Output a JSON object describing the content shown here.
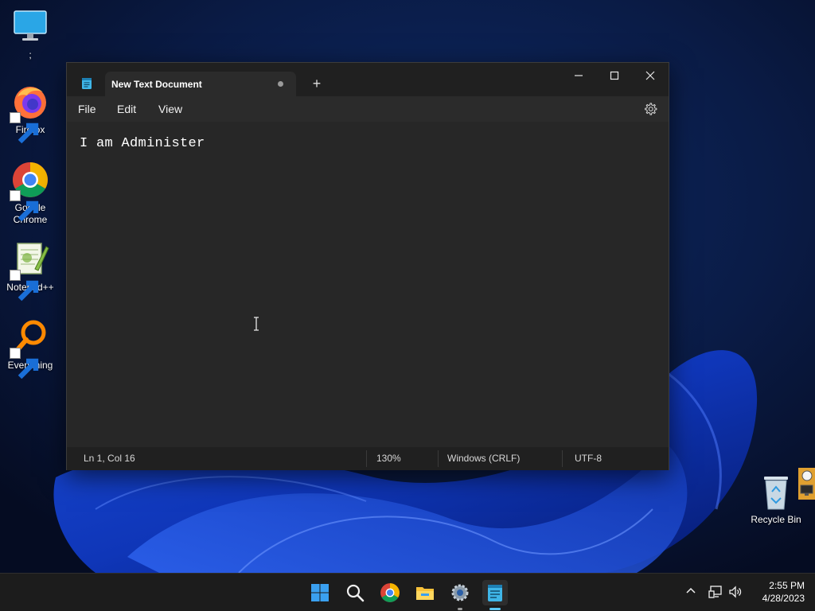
{
  "desktop": {
    "icons": [
      {
        "label": ";",
        "icon": "monitor-icon"
      },
      {
        "label": "Firefox",
        "icon": "firefox-icon"
      },
      {
        "label": "Google Chrome",
        "icon": "chrome-icon"
      },
      {
        "label": "Notepad++",
        "icon": "notepadpp-icon"
      },
      {
        "label": "Everything",
        "icon": "everything-search-icon"
      }
    ],
    "recycle_bin": {
      "label": "Recycle Bin",
      "icon": "recycle-bin-icon"
    }
  },
  "notepad": {
    "tab_title": "New Text Document",
    "new_tab_label": "+",
    "menu": {
      "file": "File",
      "edit": "Edit",
      "view": "View"
    },
    "content": "I am Administer",
    "status": {
      "position": "Ln 1, Col 16",
      "zoom": "130%",
      "line_ending": "Windows (CRLF)",
      "encoding": "UTF-8"
    }
  },
  "taskbar": {
    "pinned": [
      "windows-start-icon",
      "search-icon",
      "chrome-icon",
      "file-explorer-icon",
      "settings-icon",
      "notepad-icon"
    ],
    "clock": {
      "time": "2:55 PM",
      "date": "4/28/2023"
    }
  },
  "colors": {
    "window_bg": "#272727",
    "titlebar_bg": "#202020",
    "taskbar_bg": "#1c1c1c",
    "accent": "#5bc8f5"
  }
}
